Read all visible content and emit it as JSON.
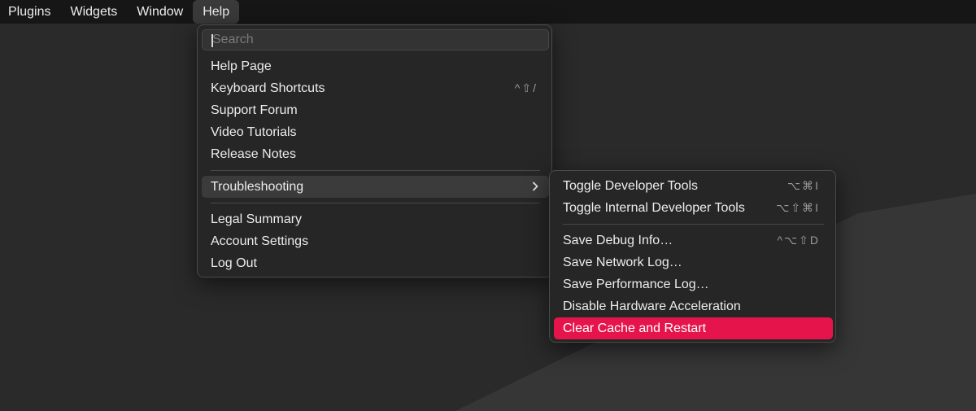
{
  "menubar": {
    "items": [
      {
        "label": "Plugins"
      },
      {
        "label": "Widgets"
      },
      {
        "label": "Window"
      },
      {
        "label": "Help"
      }
    ]
  },
  "help_menu": {
    "search": {
      "placeholder": "Search",
      "value": ""
    },
    "items": [
      {
        "label": "Help Page",
        "shortcut": ""
      },
      {
        "label": "Keyboard Shortcuts",
        "shortcut": "^⇧/"
      },
      {
        "label": "Support Forum",
        "shortcut": ""
      },
      {
        "label": "Video Tutorials",
        "shortcut": ""
      },
      {
        "label": "Release Notes",
        "shortcut": ""
      },
      {
        "label": "Troubleshooting",
        "shortcut": ""
      },
      {
        "label": "Legal Summary",
        "shortcut": ""
      },
      {
        "label": "Account Settings",
        "shortcut": ""
      },
      {
        "label": "Log Out",
        "shortcut": ""
      }
    ]
  },
  "troubleshooting_menu": {
    "items": [
      {
        "label": "Toggle Developer Tools",
        "shortcut": "⌥⌘I"
      },
      {
        "label": "Toggle Internal Developer Tools",
        "shortcut": "⌥⇧⌘I"
      },
      {
        "label": "Save Debug Info…",
        "shortcut": "^⌥⇧D"
      },
      {
        "label": "Save Network Log…",
        "shortcut": ""
      },
      {
        "label": "Save Performance Log…",
        "shortcut": ""
      },
      {
        "label": "Disable Hardware Acceleration",
        "shortcut": ""
      },
      {
        "label": "Clear Cache and Restart",
        "shortcut": ""
      }
    ]
  },
  "colors": {
    "menubar_bg": "#161616",
    "menu_bg": "#262626",
    "highlight": "#e5154c",
    "hover": "#3b3b3b",
    "text": "#ececec",
    "shortcut_text": "#9a9a9a"
  }
}
